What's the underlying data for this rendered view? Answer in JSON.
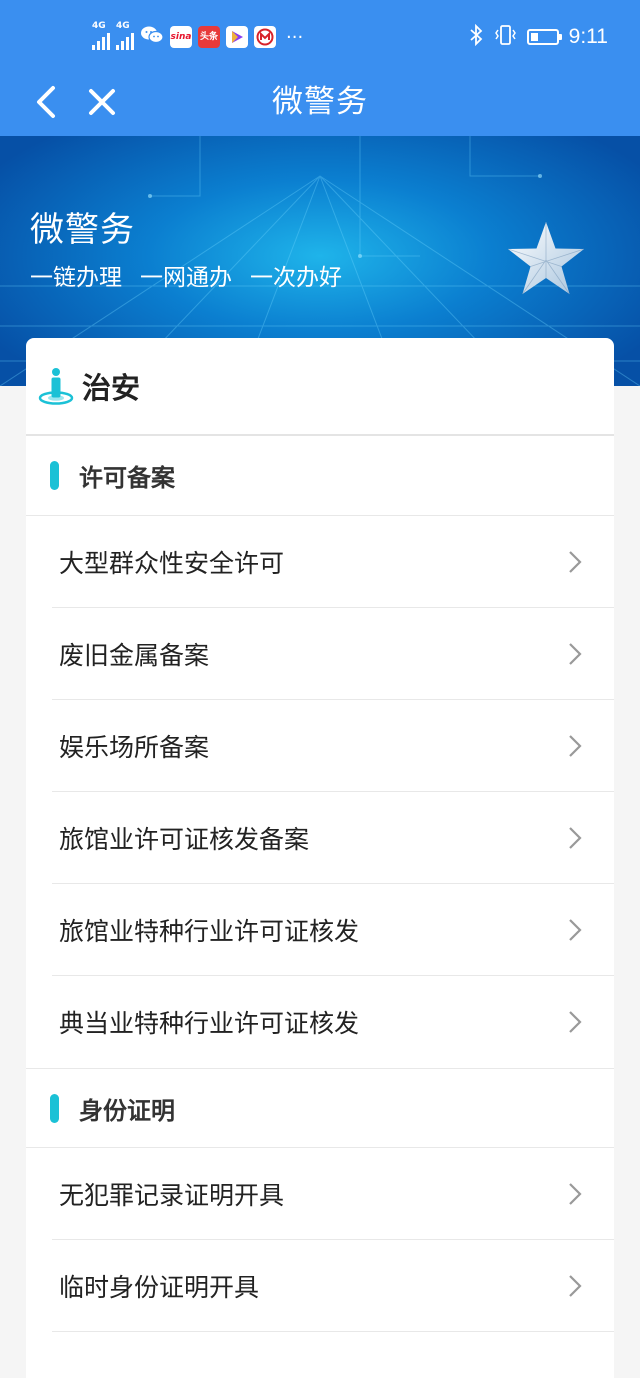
{
  "status_bar": {
    "network_1": "4G",
    "network_2": "4G",
    "app_icons": [
      {
        "name": "wechat-icon"
      },
      {
        "name": "sina-icon",
        "text": "sina"
      },
      {
        "name": "toutiao-icon",
        "text": "头条"
      },
      {
        "name": "video-icon"
      },
      {
        "name": "cmb-icon"
      }
    ],
    "more": "···",
    "battery_level": 0.3,
    "time": "9:11"
  },
  "nav": {
    "title": "微警务",
    "back_icon": "chevron-left-icon",
    "close_icon": "close-icon"
  },
  "banner": {
    "title": "微警务",
    "slogans": [
      "一链办理",
      "一网通办",
      "一次办好"
    ],
    "emblem_icon": "star-icon"
  },
  "card": {
    "icon": "person-pin-icon",
    "title": "治安",
    "sections": [
      {
        "title": "许可备案",
        "items": [
          {
            "label": "大型群众性安全许可"
          },
          {
            "label": "废旧金属备案"
          },
          {
            "label": "娱乐场所备案"
          },
          {
            "label": "旅馆业许可证核发备案"
          },
          {
            "label": "旅馆业特种行业许可证核发"
          },
          {
            "label": "典当业特种行业许可证核发"
          }
        ]
      },
      {
        "title": "身份证明",
        "items": [
          {
            "label": "无犯罪记录证明开具"
          },
          {
            "label": "临时身份证明开具"
          }
        ]
      }
    ]
  },
  "colors": {
    "header_blue": "#3a8ff0",
    "banner_blue": "#0b7fd0",
    "section_accent": "#1bc1d6",
    "text_primary": "#222222",
    "chevron": "#999999"
  }
}
